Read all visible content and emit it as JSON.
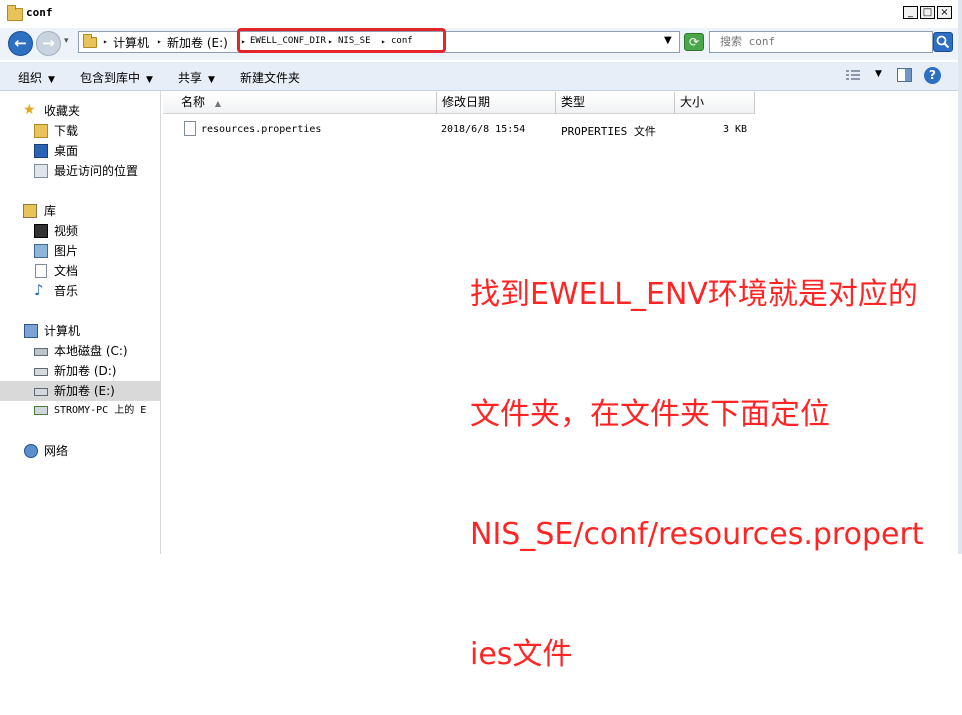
{
  "window": {
    "title": "conf",
    "min_symbol": "_",
    "max_symbol": "□",
    "close_symbol": "×"
  },
  "address_bar": {
    "crumbs": [
      "计算机",
      "新加卷 (E:)",
      "EWELL_CONF_DIR",
      "NIS_SE",
      "conf"
    ],
    "highlight_color": "#e4262b"
  },
  "search": {
    "placeholder": "搜索 conf"
  },
  "toolbar": {
    "organize": "组织",
    "include_in_library": "包含到库中",
    "share": "共享",
    "new_folder": "新建文件夹"
  },
  "sidebar": {
    "favorites": {
      "label": "收藏夹",
      "items": [
        "下载",
        "桌面",
        "最近访问的位置"
      ]
    },
    "libraries": {
      "label": "库",
      "items": [
        "视频",
        "图片",
        "文档",
        "音乐"
      ]
    },
    "computer": {
      "label": "计算机",
      "items": [
        "本地磁盘 (C:)",
        "新加卷 (D:)",
        "新加卷 (E:)",
        "STROMY-PC 上的 E"
      ]
    },
    "network": {
      "label": "网络"
    },
    "selected": "新加卷 (E:)"
  },
  "columns": {
    "name": "名称",
    "date": "修改日期",
    "type": "类型",
    "size": "大小"
  },
  "files": [
    {
      "name": "resources.properties",
      "date": "2018/6/8 15:54",
      "type": "PROPERTIES 文件",
      "size": "3 KB"
    }
  ],
  "annotation": {
    "lines": [
      "找到EWELL_ENV环境就是对应的",
      "文件夹，在文件夹下面定位",
      "NIS_SE/conf/resources.propert",
      "ies文件"
    ],
    "color": "#ff2525"
  }
}
